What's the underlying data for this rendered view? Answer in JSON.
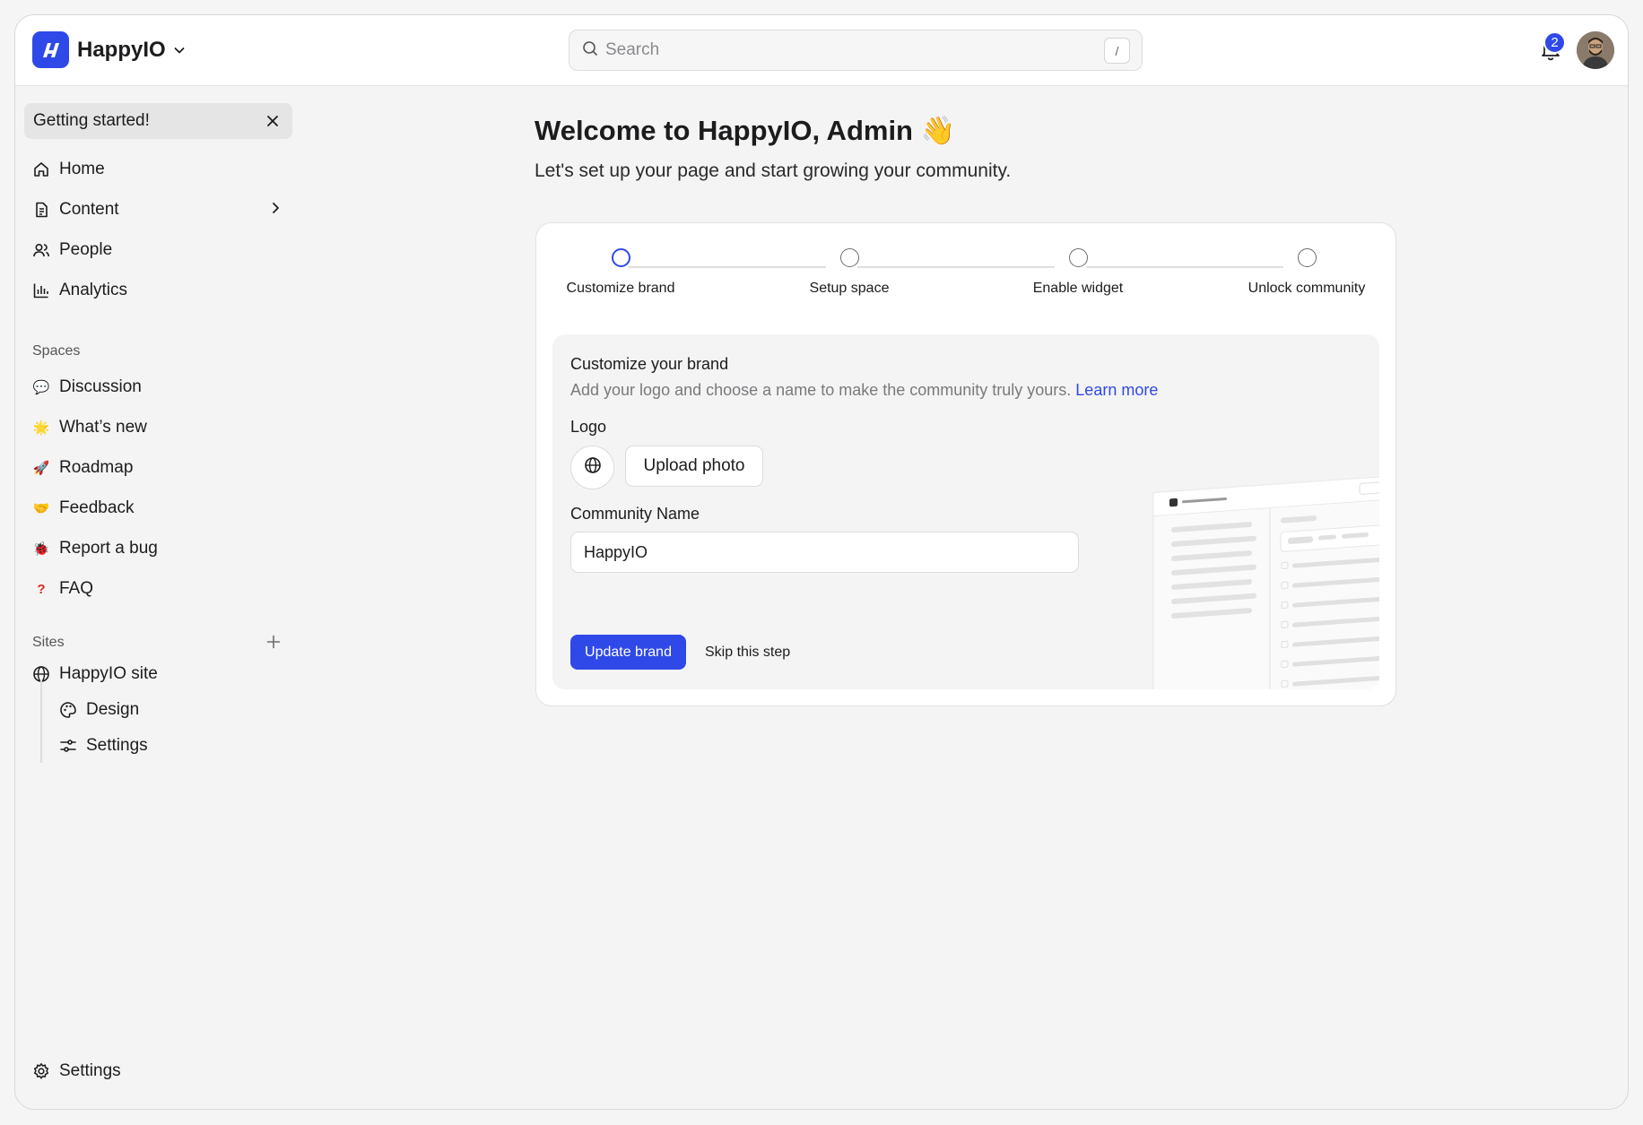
{
  "header": {
    "brand_name": "HappyIO",
    "search_placeholder": "Search",
    "search_shortcut": "/",
    "notification_count": "2"
  },
  "sidebar": {
    "getting_started": "Getting started!",
    "nav": [
      {
        "label": "Home",
        "icon": "home-icon"
      },
      {
        "label": "Content",
        "icon": "document-icon"
      },
      {
        "label": "People",
        "icon": "people-icon"
      },
      {
        "label": "Analytics",
        "icon": "bar-chart-icon"
      }
    ],
    "spaces_label": "Spaces",
    "spaces": [
      {
        "label": "Discussion",
        "emoji": "💬"
      },
      {
        "label": "What’s new",
        "emoji": "🌟"
      },
      {
        "label": "Roadmap",
        "emoji": "🚀"
      },
      {
        "label": "Feedback",
        "emoji": "🤝"
      },
      {
        "label": "Report a bug",
        "emoji": "🐞"
      },
      {
        "label": "FAQ",
        "emoji": "❓"
      }
    ],
    "sites_label": "Sites",
    "sites": [
      {
        "label": "HappyIO site",
        "icon": "globe-icon"
      },
      {
        "label": "Design",
        "icon": "palette-icon"
      },
      {
        "label": "Settings",
        "icon": "sliders-icon"
      }
    ],
    "footer_settings": "Settings"
  },
  "main": {
    "title": "Welcome to HappyIO, Admin",
    "title_emoji": "👋",
    "subtitle": "Let's set up your page and start growing your community.",
    "steps": [
      {
        "label": "Customize brand",
        "active": true
      },
      {
        "label": "Setup space",
        "active": false
      },
      {
        "label": "Enable widget",
        "active": false
      },
      {
        "label": "Unlock community",
        "active": false
      }
    ],
    "panel": {
      "title": "Customize your brand",
      "description": "Add your logo and choose a name to make the community truly yours.",
      "learn_more": "Learn more",
      "logo_label": "Logo",
      "upload_label": "Upload photo",
      "name_label": "Community Name",
      "name_value": "HappyIO",
      "update_label": "Update brand",
      "skip_label": "Skip this step"
    }
  },
  "colors": {
    "accent": "#2f49e8",
    "background": "#f4f4f4"
  }
}
